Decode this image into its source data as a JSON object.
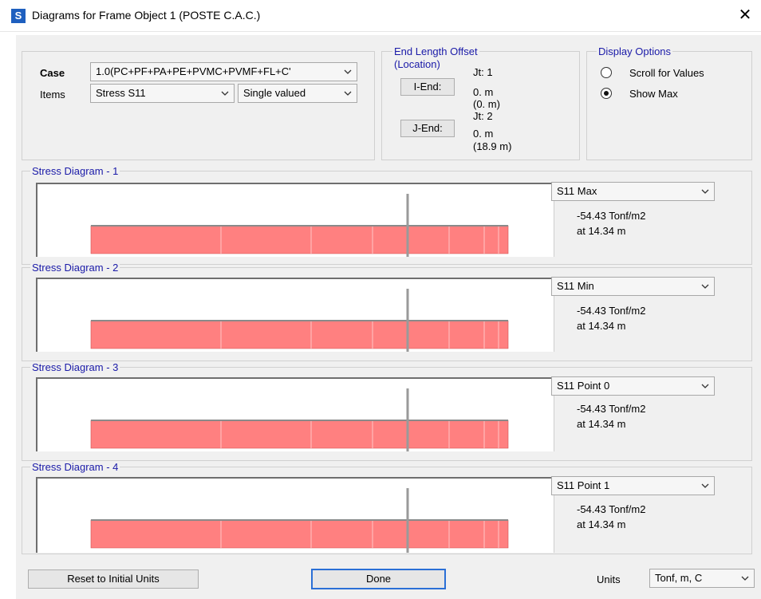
{
  "window": {
    "title": "Diagrams for Frame Object 1  (POSTE C.A.C.)",
    "icon_letter": "S",
    "close_glyph": "✕"
  },
  "case": {
    "label": "Case",
    "value": "1.0(PC+PF+PA+PE+PVMC+PVMF+FL+C'"
  },
  "items": {
    "label": "Items",
    "value": "Stress S11",
    "mode_value": "Single valued"
  },
  "end_length_offset": {
    "title": "End Length Offset",
    "subtitle": "(Location)",
    "i_end": {
      "button": "I-End:",
      "jt": "Jt:  1",
      "offset": "0. m",
      "location": "(0. m)"
    },
    "j_end": {
      "button": "J-End:",
      "jt": "Jt:  2",
      "offset": "0. m",
      "location": "(18.9 m)"
    }
  },
  "display_options": {
    "title": "Display Options",
    "options": [
      {
        "label": "Scroll for Values",
        "selected": false
      },
      {
        "label": "Show Max",
        "selected": true
      }
    ]
  },
  "diagrams": [
    {
      "title": "Stress Diagram - 1",
      "component": "S11 Max",
      "value": "-54.43 Tonf/m2",
      "location": "at 14.34 m"
    },
    {
      "title": "Stress Diagram - 2",
      "component": "S11 Min",
      "value": "-54.43 Tonf/m2",
      "location": "at 14.34 m"
    },
    {
      "title": "Stress Diagram - 3",
      "component": "S11 Point 0",
      "value": "-54.43 Tonf/m2",
      "location": "at 14.34 m"
    },
    {
      "title": "Stress Diagram - 4",
      "component": "S11 Point 1",
      "value": "-54.43 Tonf/m2",
      "location": "at 14.34 m"
    }
  ],
  "diagram_marker": {
    "location_fraction": 0.759
  },
  "footer": {
    "reset_label": "Reset to Initial Units",
    "done_label": "Done",
    "units_label": "Units",
    "units_value": "Tonf, m, C"
  },
  "colors": {
    "fill": "#ff8080",
    "edge": "#d05050",
    "legend": "#1a1aa8",
    "marker": "#9a9a9a"
  }
}
